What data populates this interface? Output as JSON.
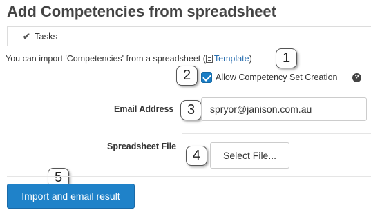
{
  "page": {
    "title": "Add Competencies from spreadsheet"
  },
  "tasks": {
    "label": "Tasks",
    "icon": "check-icon"
  },
  "intro": {
    "prefix": "You can import 'Competencies' from a spreadsheet (",
    "link_label": "Template",
    "suffix": ")"
  },
  "options": {
    "allow_set_creation_label": "Allow Competency Set Creation",
    "allow_set_creation_checked": true,
    "help_icon": "question-circle-icon"
  },
  "form": {
    "email_label": "Email Address",
    "email_value": "spryor@janison.com.au",
    "file_label": "Spreadsheet File",
    "select_file_label": "Select File..."
  },
  "actions": {
    "import_label": "Import and email result"
  },
  "callouts": [
    "1",
    "2",
    "3",
    "4",
    "5"
  ],
  "colors": {
    "primary_button": "#1f82c9",
    "link": "#2a6fb0",
    "checkbox": "#1a7ec6"
  }
}
